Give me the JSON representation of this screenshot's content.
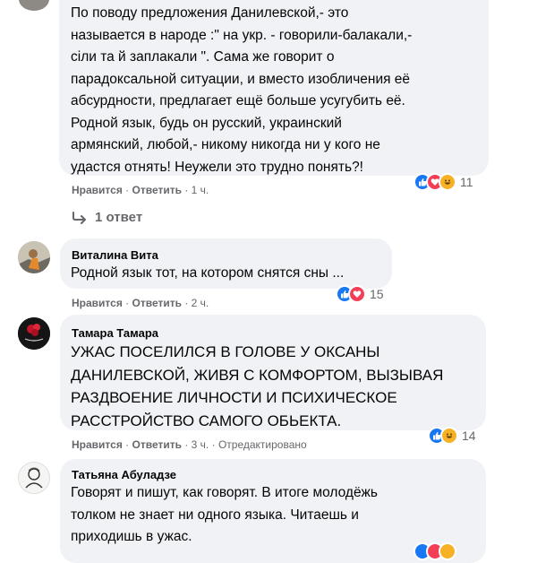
{
  "comments": [
    {
      "text": "По поводу предложения Данилевской,- это\nназывается в народе :\" на укр. - говорили-балакали,-\nсiли та й заплакали \". Сама же говорит о\nпарадоксальной ситуации, и вместо изобличения её\nабсурдности, предлагает ещё больше усугубить её.\nРодной язык, будь он русский, украинский\nармянский, любой,- никому никогда ни у кого не\nудастся отнять! Неужели это трудно понять?!",
      "like_label": "Нравится",
      "reply_label": "Ответить",
      "time": "1 ч.",
      "reaction_count": "11",
      "replies_label": "1 ответ"
    },
    {
      "author": "Виталина Вита",
      "text": "Родной язык тот, на котором снятся сны ...",
      "like_label": "Нравится",
      "reply_label": "Ответить",
      "time": "2 ч.",
      "reaction_count": "15"
    },
    {
      "author": "Тамара Тамара",
      "text": "УЖАС ПОСЕЛИЛСЯ В ГОЛОВЕ У ОКСАНЫ\nДАНИЛЕВСКОЙ, ЖИВЯ С КОМФОРТОМ, ВЫЗЫВАЯ\nРАЗДВОЕНИЕ ЛИЧНОСТИ И ПСИХИЧЕСКОЕ\nРАССТРОЙСТВО САМОГО ОБЬЕКТА.",
      "like_label": "Нравится",
      "reply_label": "Ответить",
      "time": "3 ч.",
      "edited_label": "Отредактировано",
      "reaction_count": "14"
    },
    {
      "author": "Татьяна Абуладзе",
      "text": "Говорят и пишут, как говорят. В итоге молодёжь\nтолком не знает ни одного языка. Читаешь и\nприходишь в ужас."
    }
  ],
  "separator": "·",
  "colors": {
    "bubble": "#f0f2f5",
    "meta_text": "#65676b",
    "like_blue": "#1877f2",
    "love_red": "#f33e58",
    "haha_yellow": "#f7b125"
  }
}
